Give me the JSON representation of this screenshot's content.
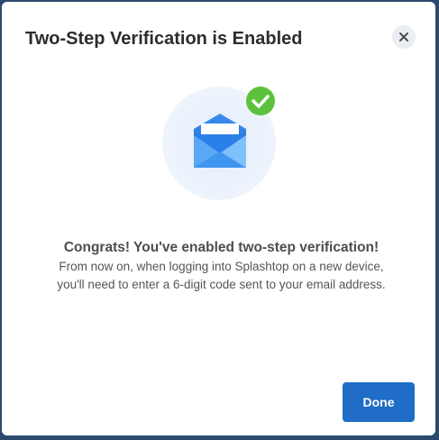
{
  "dialog": {
    "title": "Two-Step Verification is Enabled",
    "close_icon": "close-icon",
    "illustration_icons": [
      "envelope-icon",
      "check-circle-icon"
    ],
    "headline": "Congrats! You've enabled two-step verification!",
    "body_line_1": "From now on, when logging into Splashtop on a new device,",
    "body_line_2": "you'll need to enter a 6-digit code sent to your email address.",
    "done_label": "Done"
  },
  "colors": {
    "primary_button": "#1f6dc6",
    "success_check": "#5cc23d",
    "envelope_blue": "#2b8ef0"
  }
}
